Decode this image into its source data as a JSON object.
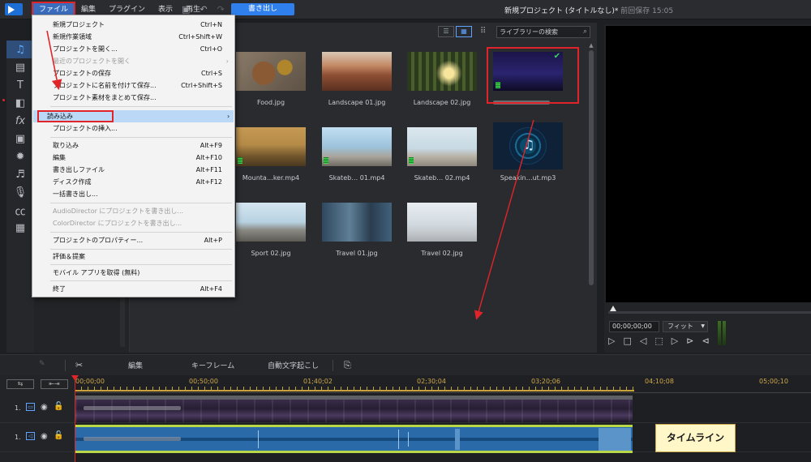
{
  "menubar": {
    "items": [
      "ファイル",
      "編集",
      "プラグイン",
      "表示",
      "再生"
    ],
    "export_label": "書き出し"
  },
  "window": {
    "title": "新規プロジェクト (タイトルなし)*",
    "saved": "前回保存 15:05"
  },
  "library": {
    "search_placeholder": "ライブラリーの検索",
    "items": [
      {
        "label": "Food.jpg"
      },
      {
        "label": "Landscape 01.jpg"
      },
      {
        "label": "Landscape 02.jpg"
      },
      {
        "label": "Mounta…ker.mp4"
      },
      {
        "label": "Skateb… 01.mp4"
      },
      {
        "label": "Skateb… 02.mp4"
      },
      {
        "label": "Speakin…ut.mp3"
      },
      {
        "label": "Sport 02.jpg"
      },
      {
        "label": "Travel 01.jpg"
      },
      {
        "label": "Travel 02.jpg"
      }
    ]
  },
  "file_menu": {
    "items": [
      {
        "label": "新規プロジェクト",
        "shortcut": "Ctrl+N"
      },
      {
        "label": "新規作業領域",
        "shortcut": "Ctrl+Shift+W"
      },
      {
        "label": "プロジェクトを開く...",
        "shortcut": "Ctrl+O"
      },
      {
        "label": "最近のプロジェクトを開く",
        "shortcut": ""
      },
      {
        "label": "プロジェクトの保存",
        "shortcut": "Ctrl+S"
      },
      {
        "label": "プロジェクトに名前を付けて保存...",
        "shortcut": "Ctrl+Shift+S"
      },
      {
        "label": "プロジェクト素材をまとめて保存...",
        "shortcut": ""
      },
      {
        "label": "読み込み",
        "shortcut": ""
      },
      {
        "label": "プロジェクトの挿入...",
        "shortcut": ""
      },
      {
        "label": "取り込み",
        "shortcut": "Alt+F9"
      },
      {
        "label": "編集",
        "shortcut": "Alt+F10"
      },
      {
        "label": "書き出しファイル",
        "shortcut": "Alt+F11"
      },
      {
        "label": "ディスク作成",
        "shortcut": "Alt+F12"
      },
      {
        "label": "一括書き出し...",
        "shortcut": ""
      },
      {
        "label": "AudioDirector にプロジェクトを書き出し...",
        "shortcut": ""
      },
      {
        "label": "ColorDirector にプロジェクトを書き出し...",
        "shortcut": ""
      },
      {
        "label": "プロジェクトのプロパティー...",
        "shortcut": "Alt+P"
      },
      {
        "label": "評価＆提案",
        "shortcut": ""
      },
      {
        "label": "モバイル アプリを取得 (無料)",
        "shortcut": ""
      },
      {
        "label": "終了",
        "shortcut": "Alt+F4"
      }
    ]
  },
  "preview": {
    "timecode": "00;00;00;00",
    "fit": "フィット"
  },
  "edit_bar": {
    "edit": "編集",
    "keyframe": "キーフレーム",
    "auto_caption": "自動文字起こし"
  },
  "timeline": {
    "ticks": [
      "00;00;00",
      "00;50;00",
      "01;40;02",
      "02;30;04",
      "03;20;06",
      "04;10;08",
      "05;00;10"
    ],
    "track1_label": "1.",
    "track2_label": "1.",
    "callout": "タイムライン"
  },
  "colors": {
    "accent": "#2f80ed",
    "annotation": "#e0242a",
    "menu_bg": "#f3f3f3"
  }
}
